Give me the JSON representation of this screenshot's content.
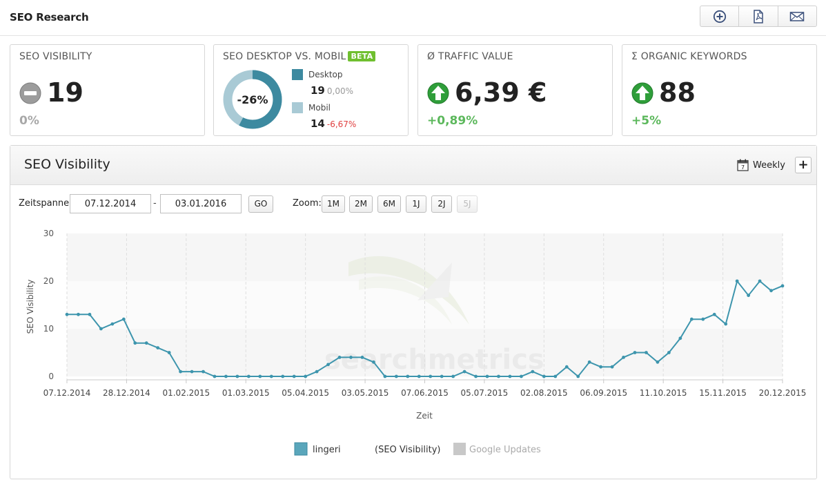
{
  "page": {
    "title": "SEO Research"
  },
  "toolbar": {
    "icons": [
      "add-circle-icon",
      "pdf-icon",
      "mail-icon"
    ]
  },
  "cards": {
    "visibility": {
      "title": "SEO VISIBILITY",
      "value": "19",
      "change": "0%",
      "icon": "neutral-minus-icon"
    },
    "desktop_mobile": {
      "title": "SEO DESKTOP VS. MOBIL",
      "badge": "BETA",
      "donut_label": "-26%",
      "desktop_share": 0.576,
      "desktop": {
        "label": "Desktop",
        "value": "19",
        "change": "0,00%"
      },
      "mobile": {
        "label": "Mobil",
        "value": "14",
        "change": "-6,67%"
      },
      "colors": {
        "desktop": "#3d8aa0",
        "mobile": "#a9cad5",
        "negative": "#e04040",
        "neutral": "#999999"
      }
    },
    "traffic": {
      "title": "Ø TRAFFIC VALUE",
      "value": "6,39 €",
      "change": "+0,89%",
      "icon": "arrow-up-icon"
    },
    "keywords": {
      "title": "Σ ORGANIC KEYWORDS",
      "value": "88",
      "change": "+5%",
      "icon": "arrow-up-icon"
    }
  },
  "panel": {
    "title": "SEO Visibility",
    "interval": "Weekly",
    "add_label": "+",
    "timespan_label": "Zeitspanne:",
    "date_from": "07.12.2014",
    "date_to": "03.01.2016",
    "separator": "-",
    "go_label": "GO",
    "zoom_label": "Zoom:",
    "zoom_options": [
      "1M",
      "2M",
      "6M",
      "1J",
      "2J",
      "5J"
    ],
    "zoom_disabled": [
      "5J"
    ]
  },
  "colors": {
    "accent": "#3d95ad",
    "positive": "#5cb85c",
    "neutral": "#a8a8a8",
    "google_updates": "#c8c8c8"
  },
  "chart_data": {
    "type": "line",
    "watermark": "searchmetrics",
    "xlabel": "Zeit",
    "ylabel": "SEO Visibility",
    "ylim": [
      0,
      30
    ],
    "yticks": [
      0,
      10,
      20,
      30
    ],
    "x_tick_labels": [
      "07.12.2014",
      "28.12.2014",
      "01.02.2015",
      "01.03.2015",
      "05.04.2015",
      "03.05.2015",
      "07.06.2015",
      "05.07.2015",
      "02.08.2015",
      "06.09.2015",
      "11.10.2015",
      "15.11.2015",
      "20.12.2015"
    ],
    "legend_position": "bottom",
    "legend": [
      {
        "name": "lingeri",
        "suffix": "(SEO Visibility)",
        "color": "#3d95ad"
      },
      {
        "name": "Google Updates",
        "color": "#c8c8c8",
        "disabled": true
      }
    ],
    "series": [
      {
        "name": "lingeri",
        "values": [
          13,
          13,
          13,
          10,
          11,
          12,
          7,
          7,
          6,
          5,
          1,
          1,
          1,
          0,
          0,
          0,
          0,
          0,
          0,
          0,
          0,
          0,
          1,
          2.5,
          4,
          4,
          4,
          3,
          0,
          0,
          0,
          0,
          0,
          0,
          0,
          1,
          0,
          0,
          0,
          0,
          0,
          1,
          0,
          0,
          2,
          0,
          3,
          2,
          2,
          4,
          5,
          5,
          3,
          5,
          8,
          12,
          12,
          13,
          11,
          20,
          17,
          20,
          18,
          19
        ]
      }
    ]
  }
}
